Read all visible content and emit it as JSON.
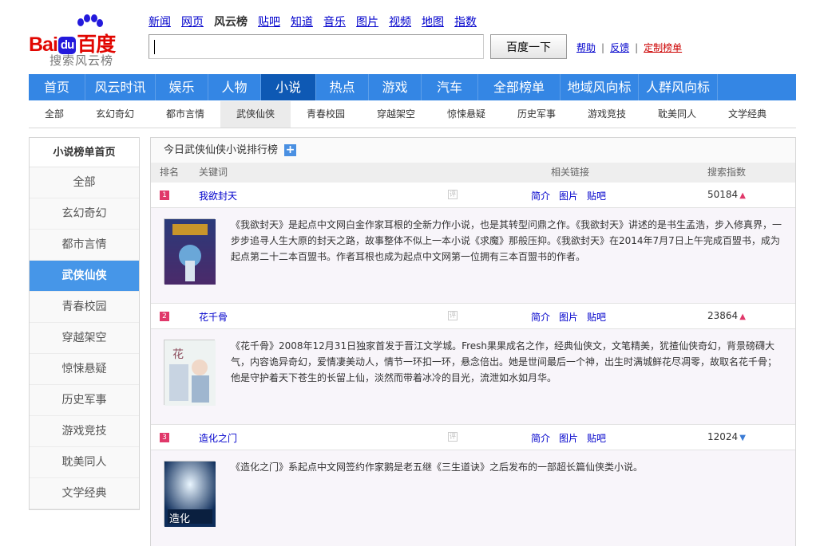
{
  "logo": {
    "left": "Bai",
    "badge": "du",
    "right": "百度",
    "subtitle": "搜索风云榜"
  },
  "topnav": [
    "新闻",
    "网页",
    "风云榜",
    "贴吧",
    "知道",
    "音乐",
    "图片",
    "视频",
    "地图",
    "指数"
  ],
  "topnav_current": "风云榜",
  "search": {
    "button": "百度一下",
    "value": ""
  },
  "toplinks": {
    "help": "帮助",
    "feedback": "反馈",
    "custom": "定制榜单",
    "sep": "|"
  },
  "mainnav": [
    "首页",
    "风云时讯",
    "娱乐",
    "人物",
    "小说",
    "热点",
    "游戏",
    "汽车",
    "全部榜单",
    "地域风向标",
    "人群风向标"
  ],
  "mainnav_active": "小说",
  "subnav": [
    "全部",
    "玄幻奇幻",
    "都市言情",
    "武侠仙侠",
    "青春校园",
    "穿越架空",
    "惊悚悬疑",
    "历史军事",
    "游戏竞技",
    "耽美同人",
    "文学经典"
  ],
  "subnav_active": "武侠仙侠",
  "sidebar": {
    "head": "小说榜单首页",
    "items": [
      "全部",
      "玄幻奇幻",
      "都市言情",
      "武侠仙侠",
      "青春校园",
      "穿越架空",
      "惊悚悬疑",
      "历史军事",
      "游戏竞技",
      "耽美同人",
      "文学经典"
    ],
    "active": "武侠仙侠"
  },
  "board": {
    "title": "今日武侠仙侠小说排行榜",
    "plus": "+",
    "cols": {
      "rank": "排名",
      "keyword": "关键词",
      "links": "相关链接",
      "index": "搜索指数"
    },
    "tag": "评",
    "link_labels": [
      "简介",
      "图片",
      "贴吧"
    ],
    "rows": [
      {
        "rank": "1",
        "keyword": "我欲封天",
        "index": "50184",
        "trend": "up",
        "desc": "《我欲封天》是起点中文网白金作家耳根的全新力作小说，也是其转型问鼎之作。《我欲封天》讲述的是书生孟浩，步入修真界，一步步追寻人生大原的封天之路，故事整体不似上一本小说《求魔》那般压抑。《我欲封天》在2014年7月7日上午完成百盟书，成为起点第二十二本百盟书。作者耳根也成为起点中文网第一位拥有三本百盟书的作者。"
      },
      {
        "rank": "2",
        "keyword": "花千骨",
        "index": "23864",
        "trend": "up",
        "desc": "《花千骨》2008年12月31日独家首发于晋江文学城。Fresh果果成名之作，经典仙侠文，文笔精美，犹揸仙侠奇幻，背景磅礴大气，内容诡异奇幻，爱情凄美动人，情节一环扣一环，悬念倍出。她是世间最后一个神，出生时满城鲜花尽凋零，故取名花千骨；他是守护着天下苍生的长留上仙，淡然而带着冰冷的目光，流泄如水如月华。"
      },
      {
        "rank": "3",
        "keyword": "造化之门",
        "index": "12024",
        "trend": "down",
        "desc": "《造化之门》系起点中文网签约作家鹅是老五继《三生道诀》之后发布的一部超长篇仙侠类小说。"
      }
    ]
  },
  "colors": {
    "nav": "#3486e4",
    "nav_active": "#0e59b4",
    "sidebar_active": "#4696e8",
    "rank": "#e0386a",
    "link": "#0000cc"
  },
  "icons": [
    "baidu-paw-icon",
    "plus-icon",
    "review-tag-icon",
    "trend-up-icon",
    "trend-down-icon"
  ]
}
